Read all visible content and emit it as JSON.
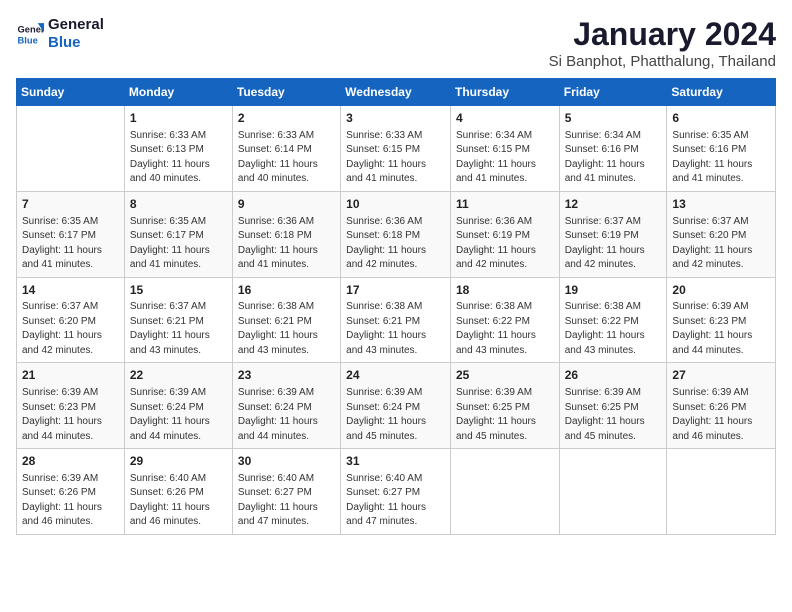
{
  "logo": {
    "line1": "General",
    "line2": "Blue"
  },
  "title": "January 2024",
  "subtitle": "Si Banphot, Phatthalung, Thailand",
  "days_header": [
    "Sunday",
    "Monday",
    "Tuesday",
    "Wednesday",
    "Thursday",
    "Friday",
    "Saturday"
  ],
  "weeks": [
    [
      {
        "day": "",
        "info": ""
      },
      {
        "day": "1",
        "info": "Sunrise: 6:33 AM\nSunset: 6:13 PM\nDaylight: 11 hours\nand 40 minutes."
      },
      {
        "day": "2",
        "info": "Sunrise: 6:33 AM\nSunset: 6:14 PM\nDaylight: 11 hours\nand 40 minutes."
      },
      {
        "day": "3",
        "info": "Sunrise: 6:33 AM\nSunset: 6:15 PM\nDaylight: 11 hours\nand 41 minutes."
      },
      {
        "day": "4",
        "info": "Sunrise: 6:34 AM\nSunset: 6:15 PM\nDaylight: 11 hours\nand 41 minutes."
      },
      {
        "day": "5",
        "info": "Sunrise: 6:34 AM\nSunset: 6:16 PM\nDaylight: 11 hours\nand 41 minutes."
      },
      {
        "day": "6",
        "info": "Sunrise: 6:35 AM\nSunset: 6:16 PM\nDaylight: 11 hours\nand 41 minutes."
      }
    ],
    [
      {
        "day": "7",
        "info": "Sunrise: 6:35 AM\nSunset: 6:17 PM\nDaylight: 11 hours\nand 41 minutes."
      },
      {
        "day": "8",
        "info": "Sunrise: 6:35 AM\nSunset: 6:17 PM\nDaylight: 11 hours\nand 41 minutes."
      },
      {
        "day": "9",
        "info": "Sunrise: 6:36 AM\nSunset: 6:18 PM\nDaylight: 11 hours\nand 41 minutes."
      },
      {
        "day": "10",
        "info": "Sunrise: 6:36 AM\nSunset: 6:18 PM\nDaylight: 11 hours\nand 42 minutes."
      },
      {
        "day": "11",
        "info": "Sunrise: 6:36 AM\nSunset: 6:19 PM\nDaylight: 11 hours\nand 42 minutes."
      },
      {
        "day": "12",
        "info": "Sunrise: 6:37 AM\nSunset: 6:19 PM\nDaylight: 11 hours\nand 42 minutes."
      },
      {
        "day": "13",
        "info": "Sunrise: 6:37 AM\nSunset: 6:20 PM\nDaylight: 11 hours\nand 42 minutes."
      }
    ],
    [
      {
        "day": "14",
        "info": "Sunrise: 6:37 AM\nSunset: 6:20 PM\nDaylight: 11 hours\nand 42 minutes."
      },
      {
        "day": "15",
        "info": "Sunrise: 6:37 AM\nSunset: 6:21 PM\nDaylight: 11 hours\nand 43 minutes."
      },
      {
        "day": "16",
        "info": "Sunrise: 6:38 AM\nSunset: 6:21 PM\nDaylight: 11 hours\nand 43 minutes."
      },
      {
        "day": "17",
        "info": "Sunrise: 6:38 AM\nSunset: 6:21 PM\nDaylight: 11 hours\nand 43 minutes."
      },
      {
        "day": "18",
        "info": "Sunrise: 6:38 AM\nSunset: 6:22 PM\nDaylight: 11 hours\nand 43 minutes."
      },
      {
        "day": "19",
        "info": "Sunrise: 6:38 AM\nSunset: 6:22 PM\nDaylight: 11 hours\nand 43 minutes."
      },
      {
        "day": "20",
        "info": "Sunrise: 6:39 AM\nSunset: 6:23 PM\nDaylight: 11 hours\nand 44 minutes."
      }
    ],
    [
      {
        "day": "21",
        "info": "Sunrise: 6:39 AM\nSunset: 6:23 PM\nDaylight: 11 hours\nand 44 minutes."
      },
      {
        "day": "22",
        "info": "Sunrise: 6:39 AM\nSunset: 6:24 PM\nDaylight: 11 hours\nand 44 minutes."
      },
      {
        "day": "23",
        "info": "Sunrise: 6:39 AM\nSunset: 6:24 PM\nDaylight: 11 hours\nand 44 minutes."
      },
      {
        "day": "24",
        "info": "Sunrise: 6:39 AM\nSunset: 6:24 PM\nDaylight: 11 hours\nand 45 minutes."
      },
      {
        "day": "25",
        "info": "Sunrise: 6:39 AM\nSunset: 6:25 PM\nDaylight: 11 hours\nand 45 minutes."
      },
      {
        "day": "26",
        "info": "Sunrise: 6:39 AM\nSunset: 6:25 PM\nDaylight: 11 hours\nand 45 minutes."
      },
      {
        "day": "27",
        "info": "Sunrise: 6:39 AM\nSunset: 6:26 PM\nDaylight: 11 hours\nand 46 minutes."
      }
    ],
    [
      {
        "day": "28",
        "info": "Sunrise: 6:39 AM\nSunset: 6:26 PM\nDaylight: 11 hours\nand 46 minutes."
      },
      {
        "day": "29",
        "info": "Sunrise: 6:40 AM\nSunset: 6:26 PM\nDaylight: 11 hours\nand 46 minutes."
      },
      {
        "day": "30",
        "info": "Sunrise: 6:40 AM\nSunset: 6:27 PM\nDaylight: 11 hours\nand 47 minutes."
      },
      {
        "day": "31",
        "info": "Sunrise: 6:40 AM\nSunset: 6:27 PM\nDaylight: 11 hours\nand 47 minutes."
      },
      {
        "day": "",
        "info": ""
      },
      {
        "day": "",
        "info": ""
      },
      {
        "day": "",
        "info": ""
      }
    ]
  ]
}
